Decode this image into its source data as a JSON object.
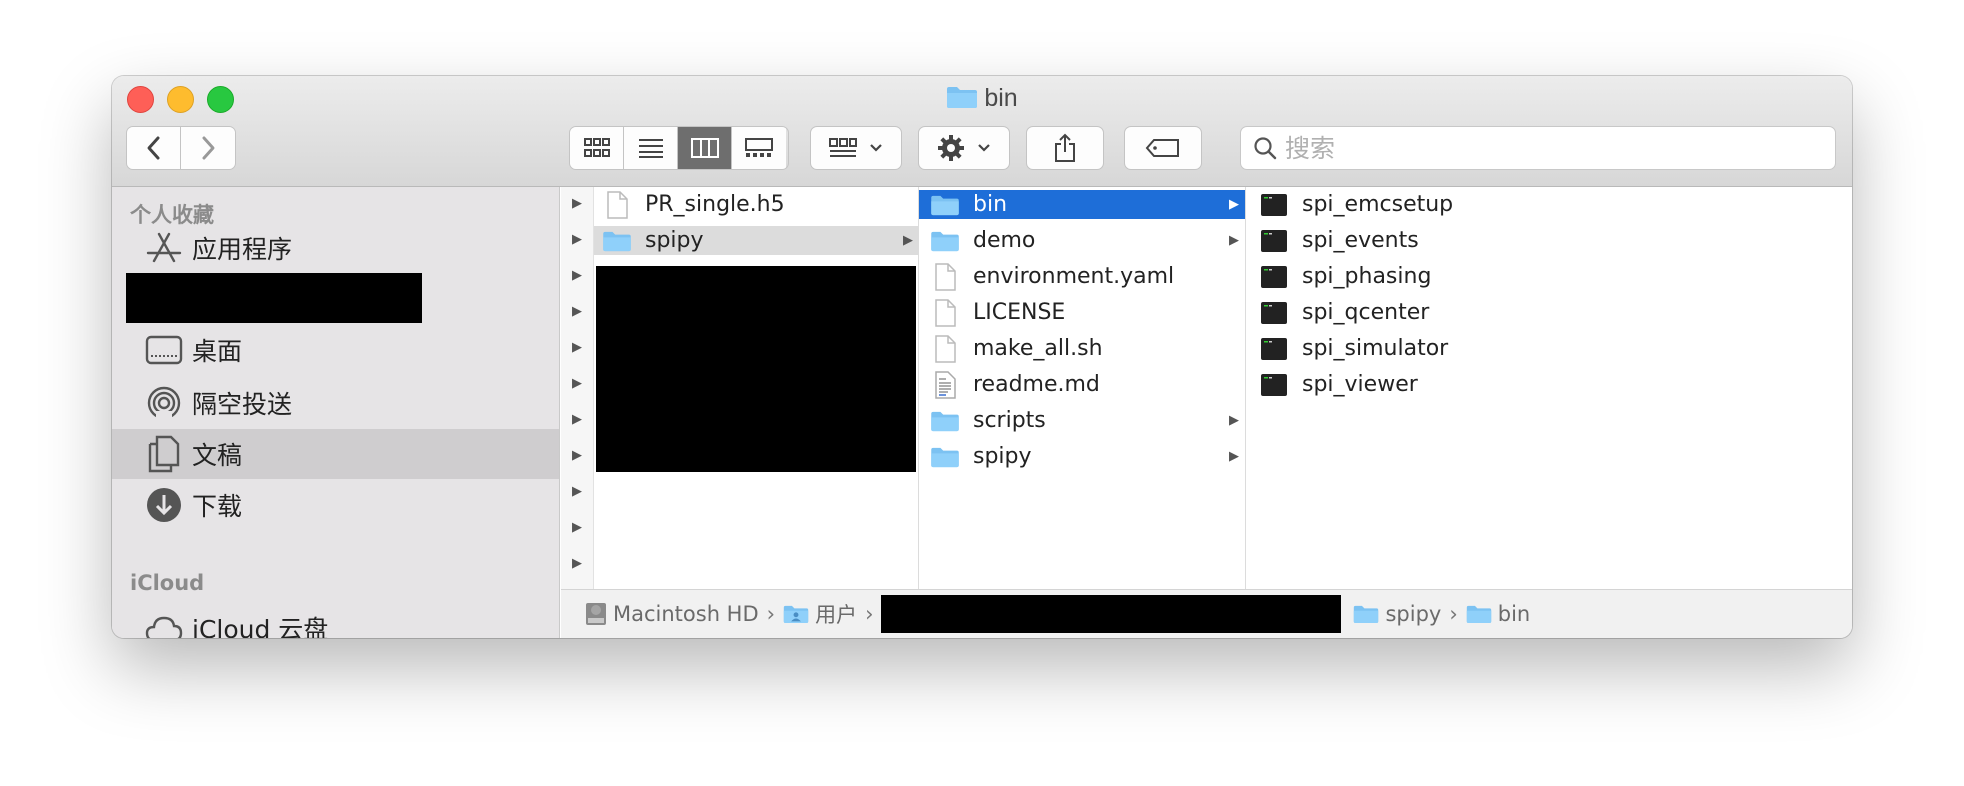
{
  "window": {
    "title": "bin"
  },
  "toolbar": {
    "search_placeholder": "搜索",
    "view_modes": [
      "icon-view",
      "list-view",
      "column-view",
      "gallery-view"
    ],
    "active_view": "column-view"
  },
  "sidebar": {
    "favorites_header": "个人收藏",
    "favorites": [
      {
        "label": "应用程序",
        "icon": "applications-icon"
      },
      {
        "label": "桌面",
        "icon": "desktop-icon"
      },
      {
        "label": "隔空投送",
        "icon": "airdrop-icon"
      },
      {
        "label": "文稿",
        "icon": "documents-icon",
        "selected": true
      },
      {
        "label": "下载",
        "icon": "downloads-icon"
      }
    ],
    "icloud_header": "iCloud",
    "icloud": [
      {
        "label": "iCloud 云盘",
        "icon": "cloud-icon"
      }
    ]
  },
  "columns": {
    "col1": [
      {
        "name": "PR_single.h5",
        "kind": "file"
      },
      {
        "name": "spipy",
        "kind": "folder",
        "selected": true
      }
    ],
    "col2": [
      {
        "name": "bin",
        "kind": "folder",
        "selected": true
      },
      {
        "name": "demo",
        "kind": "folder"
      },
      {
        "name": "environment.yaml",
        "kind": "file"
      },
      {
        "name": "LICENSE",
        "kind": "file"
      },
      {
        "name": "make_all.sh",
        "kind": "file"
      },
      {
        "name": "readme.md",
        "kind": "text-file"
      },
      {
        "name": "scripts",
        "kind": "folder"
      },
      {
        "name": "spipy",
        "kind": "folder"
      }
    ],
    "col3": [
      {
        "name": "spi_emcsetup",
        "kind": "executable"
      },
      {
        "name": "spi_events",
        "kind": "executable"
      },
      {
        "name": "spi_phasing",
        "kind": "executable"
      },
      {
        "name": "spi_qcenter",
        "kind": "executable"
      },
      {
        "name": "spi_simulator",
        "kind": "executable"
      },
      {
        "name": "spi_viewer",
        "kind": "executable"
      }
    ]
  },
  "pathbar": {
    "disk": "Macintosh HD",
    "users": "用户",
    "spipy": "spipy",
    "bin": "bin",
    "separator": "›"
  }
}
